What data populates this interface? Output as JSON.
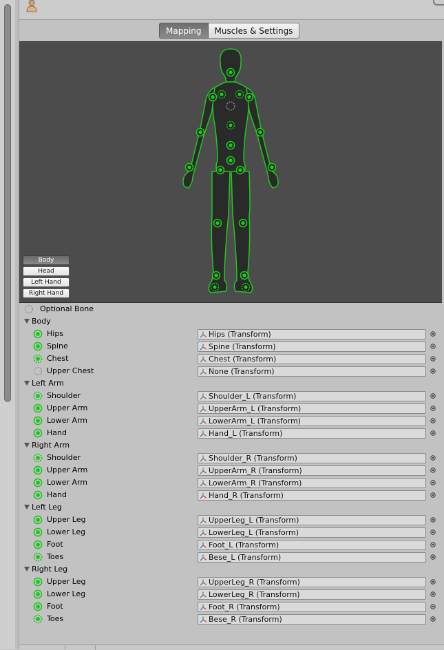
{
  "header": {
    "avatar_icon": "avatar-mannequin-icon"
  },
  "tabs": [
    {
      "label": "Mapping",
      "active": true
    },
    {
      "label": "Muscles & Settings",
      "active": false
    }
  ],
  "body_part_buttons": [
    {
      "label": "Body",
      "active": true
    },
    {
      "label": "Head",
      "active": false
    },
    {
      "label": "Left Hand",
      "active": false
    },
    {
      "label": "Right Hand",
      "active": false
    }
  ],
  "legend": {
    "optional_label": "Optional Bone"
  },
  "colors": {
    "mapped": "#1ec91e",
    "view_bg": "#4c4c4c",
    "silhouette_fill": "#2a2a2a"
  },
  "sections": [
    {
      "name": "Body",
      "bones": [
        {
          "label": "Hips",
          "value": "Hips (Transform)",
          "status": "required"
        },
        {
          "label": "Spine",
          "value": "Spine (Transform)",
          "status": "required"
        },
        {
          "label": "Chest",
          "value": "Chest (Transform)",
          "status": "optional-mapped"
        },
        {
          "label": "Upper Chest",
          "value": "None (Transform)",
          "status": "optional-empty"
        }
      ]
    },
    {
      "name": "Left Arm",
      "bones": [
        {
          "label": "Shoulder",
          "value": "Shoulder_L (Transform)",
          "status": "optional-mapped"
        },
        {
          "label": "Upper Arm",
          "value": "UpperArm_L (Transform)",
          "status": "required"
        },
        {
          "label": "Lower Arm",
          "value": "LowerArm_L (Transform)",
          "status": "required"
        },
        {
          "label": "Hand",
          "value": "Hand_L (Transform)",
          "status": "required"
        }
      ]
    },
    {
      "name": "Right Arm",
      "bones": [
        {
          "label": "Shoulder",
          "value": "Shoulder_R (Transform)",
          "status": "optional-mapped"
        },
        {
          "label": "Upper Arm",
          "value": "UpperArm_R (Transform)",
          "status": "required"
        },
        {
          "label": "Lower Arm",
          "value": "LowerArm_R (Transform)",
          "status": "required"
        },
        {
          "label": "Hand",
          "value": "Hand_R (Transform)",
          "status": "required"
        }
      ]
    },
    {
      "name": "Left Leg",
      "bones": [
        {
          "label": "Upper Leg",
          "value": "UpperLeg_L (Transform)",
          "status": "required"
        },
        {
          "label": "Lower Leg",
          "value": "LowerLeg_L (Transform)",
          "status": "required"
        },
        {
          "label": "Foot",
          "value": "Foot_L (Transform)",
          "status": "required"
        },
        {
          "label": "Toes",
          "value": "Bese_L (Transform)",
          "status": "optional-mapped"
        }
      ]
    },
    {
      "name": "Right Leg",
      "bones": [
        {
          "label": "Upper Leg",
          "value": "UpperLeg_R (Transform)",
          "status": "required"
        },
        {
          "label": "Lower Leg",
          "value": "LowerLeg_R (Transform)",
          "status": "required"
        },
        {
          "label": "Foot",
          "value": "Foot_R (Transform)",
          "status": "required"
        },
        {
          "label": "Toes",
          "value": "Bese_R (Transform)",
          "status": "optional-mapped"
        }
      ]
    }
  ]
}
